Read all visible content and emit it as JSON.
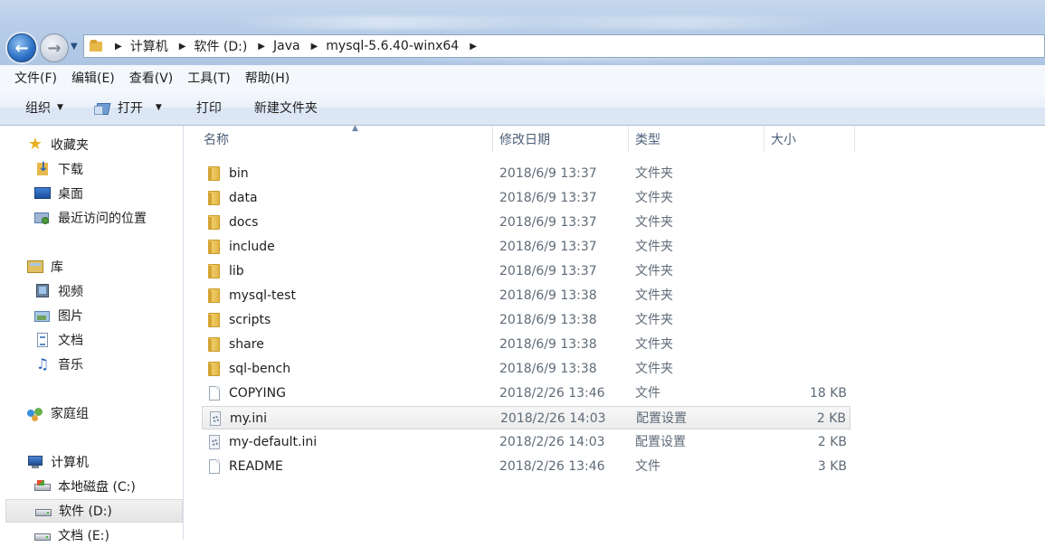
{
  "breadcrumbs": [
    "计算机",
    "软件 (D:)",
    "Java",
    "mysql-5.6.40-winx64"
  ],
  "menu": [
    "文件(F)",
    "编辑(E)",
    "查看(V)",
    "工具(T)",
    "帮助(H)"
  ],
  "toolbar": {
    "organize": "组织",
    "open": "打开",
    "print": "打印",
    "new_folder": "新建文件夹"
  },
  "nav": {
    "favorites": "收藏夹",
    "downloads": "下载",
    "desktop": "桌面",
    "recent": "最近访问的位置",
    "libraries": "库",
    "videos": "视频",
    "pictures": "图片",
    "documents": "文档",
    "music": "音乐",
    "homegroup": "家庭组",
    "computer": "计算机",
    "drive_c": "本地磁盘 (C:)",
    "drive_d": "软件 (D:)",
    "drive_e": "文档 (E:)"
  },
  "columns": {
    "name": "名称",
    "date": "修改日期",
    "type": "类型",
    "size": "大小"
  },
  "files": [
    {
      "name": "bin",
      "date": "2018/6/9 13:37",
      "type": "文件夹",
      "size": "",
      "icon": "folder-icon"
    },
    {
      "name": "data",
      "date": "2018/6/9 13:37",
      "type": "文件夹",
      "size": "",
      "icon": "folder-icon"
    },
    {
      "name": "docs",
      "date": "2018/6/9 13:37",
      "type": "文件夹",
      "size": "",
      "icon": "folder-icon"
    },
    {
      "name": "include",
      "date": "2018/6/9 13:37",
      "type": "文件夹",
      "size": "",
      "icon": "folder-icon"
    },
    {
      "name": "lib",
      "date": "2018/6/9 13:37",
      "type": "文件夹",
      "size": "",
      "icon": "folder-icon"
    },
    {
      "name": "mysql-test",
      "date": "2018/6/9 13:38",
      "type": "文件夹",
      "size": "",
      "icon": "folder-icon"
    },
    {
      "name": "scripts",
      "date": "2018/6/9 13:38",
      "type": "文件夹",
      "size": "",
      "icon": "folder-icon"
    },
    {
      "name": "share",
      "date": "2018/6/9 13:38",
      "type": "文件夹",
      "size": "",
      "icon": "folder-icon"
    },
    {
      "name": "sql-bench",
      "date": "2018/6/9 13:38",
      "type": "文件夹",
      "size": "",
      "icon": "folder-icon"
    },
    {
      "name": "COPYING",
      "date": "2018/2/26 13:46",
      "type": "文件",
      "size": "18 KB",
      "icon": "file-icon"
    },
    {
      "name": "my.ini",
      "date": "2018/2/26 14:03",
      "type": "配置设置",
      "size": "2 KB",
      "icon": "config-icon"
    },
    {
      "name": "my-default.ini",
      "date": "2018/2/26 14:03",
      "type": "配置设置",
      "size": "2 KB",
      "icon": "config-icon"
    },
    {
      "name": "README",
      "date": "2018/2/26 13:46",
      "type": "文件",
      "size": "3 KB",
      "icon": "file-icon"
    }
  ]
}
